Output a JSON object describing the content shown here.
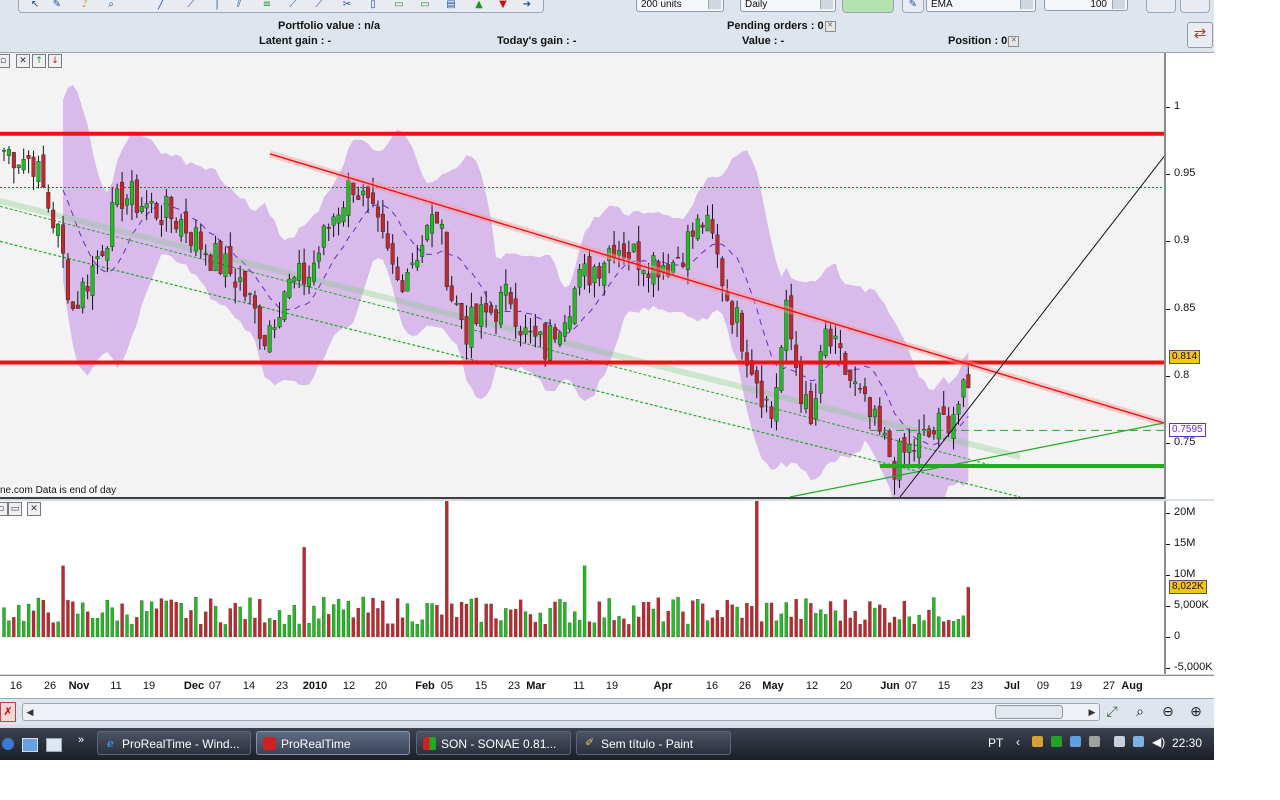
{
  "infobar": {
    "portfolio_value": "Portfolio value : n/a",
    "latent_gain": "Latent gain : -",
    "todays_gain": "Today's gain : -",
    "pending_orders": "Pending orders : 0",
    "value": "Value : -",
    "position": "Position : 0"
  },
  "toolbar": {
    "units_combo": "200 units",
    "period_combo": "Daily",
    "indicator_combo": "EMA",
    "count_combo": "100"
  },
  "price_axis": {
    "ticks": [
      "1",
      "0.95",
      "0.9",
      "0.85",
      "0.8",
      "0.75"
    ],
    "last_price_tag": "0.814",
    "ema_tag": "0.7595"
  },
  "volume_axis": {
    "ticks": [
      "20M",
      "15M",
      "10M",
      "5,000K",
      "0",
      "-5,000K"
    ],
    "last_volume_tag": "8,022K"
  },
  "date_axis": {
    "labels": [
      "16",
      "26",
      "Nov",
      "11",
      "19",
      "Dec",
      "07",
      "14",
      "23",
      "2010",
      "12",
      "20",
      "Feb",
      "05",
      "15",
      "23",
      "Mar",
      "11",
      "19",
      "Apr",
      "16",
      "26",
      "May",
      "12",
      "20",
      "Jun",
      "07",
      "15",
      "23",
      "Jul",
      "09",
      "19",
      "27",
      "Aug"
    ],
    "major": [
      "Nov",
      "Dec",
      "2010",
      "Feb",
      "Mar",
      "Apr",
      "May",
      "Jun",
      "Jul",
      "Aug"
    ]
  },
  "chart_credit": "ne.com  Data is end of day",
  "chart_data": {
    "type": "candlestick",
    "instrument": "SON - SONAE",
    "price_ylim": [
      0.71,
      1.04
    ],
    "volume_ylim": [
      -6000000,
      22000000
    ],
    "horizontal_lines": [
      {
        "price": 0.98,
        "color": "#ee1111",
        "style": "solid-thick"
      },
      {
        "price": 0.94,
        "color": "#dd2222",
        "style": "dotted"
      },
      {
        "price": 0.81,
        "color": "#ee1111",
        "style": "solid-thick"
      },
      {
        "price": 0.7595,
        "color": "#22aa22",
        "style": "dashed"
      },
      {
        "price": 0.733,
        "color": "#22aa22",
        "style": "solid-thick"
      }
    ],
    "last_close": 0.814,
    "ema_value": 0.7595,
    "last_volume": 8022000
  },
  "taskbar": {
    "buttons": [
      "ProRealTime - Wind...",
      "ProRealTime",
      "SON - SONAE   0.81...",
      "Sem título - Paint"
    ],
    "lang": "PT",
    "clock": "22:30"
  },
  "colors": {
    "up_candle": "#22bb22",
    "down_candle": "#c0282e",
    "bollinger_band": "#cfa8e8",
    "support_line": "#22aa22",
    "resistance_line": "#ee1111"
  }
}
